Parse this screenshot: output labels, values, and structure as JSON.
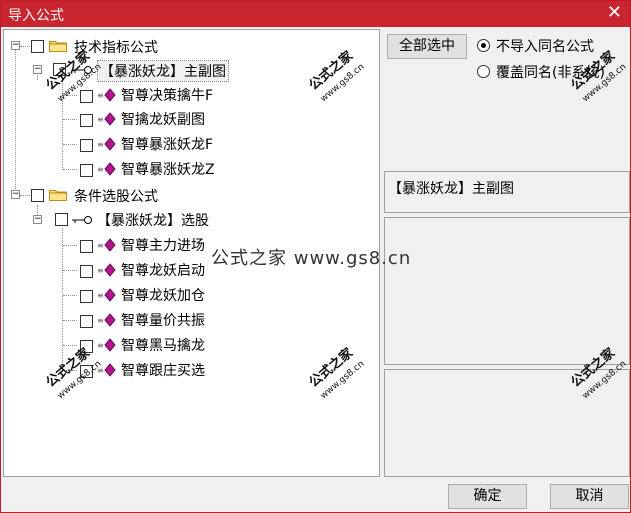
{
  "window": {
    "title": "导入公式",
    "close_glyph": "✕"
  },
  "tree": {
    "nodes": [
      {
        "label": "技术指标公式"
      },
      {
        "label": "【暴涨妖龙】主副图"
      },
      {
        "label": "智尊决策擒牛F"
      },
      {
        "label": "智擒龙妖副图"
      },
      {
        "label": "智尊暴涨妖龙F"
      },
      {
        "label": "智尊暴涨妖龙Z"
      },
      {
        "label": "条件选股公式"
      },
      {
        "label": "【暴涨妖龙】选股"
      },
      {
        "label": "智尊主力进场"
      },
      {
        "label": "智尊龙妖启动"
      },
      {
        "label": "智尊龙妖加仓"
      },
      {
        "label": "智尊量价共振"
      },
      {
        "label": "智尊黑马擒龙"
      },
      {
        "label": "智尊跟庄买选"
      }
    ],
    "expander_collapse": "−"
  },
  "options": {
    "select_all_label": "全部选中",
    "radio_skip_label": "不导入同名公式",
    "radio_overwrite_label": "覆盖同名(非系统)",
    "selected_radio": "skip"
  },
  "info": {
    "selected_name": "【暴涨妖龙】主副图"
  },
  "footer": {
    "ok_label": "确定",
    "cancel_label": "取消"
  },
  "watermark": {
    "center_text": "公式之家 www.gs8.cn",
    "stamp_text": "公式之家",
    "stamp_url": "www.gs8.cn"
  },
  "colors": {
    "titlebar": "#c9252f",
    "gem": "#b0168f"
  }
}
